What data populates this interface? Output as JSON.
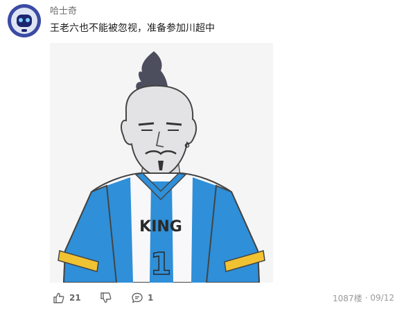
{
  "post": {
    "username": "哈士奇",
    "text": "王老六也不能被忽视，准备参加川超中",
    "image_jersey_text": "KING",
    "image_jersey_number": "1"
  },
  "footer": {
    "like_count": "21",
    "reply_count": "1",
    "floor": "1087楼",
    "separator": "·",
    "date": "09/12"
  },
  "colors": {
    "avatar_bg": "#2b3a8c",
    "jersey_blue": "#2f8fd8",
    "jersey_stripe": "#f1c232"
  }
}
